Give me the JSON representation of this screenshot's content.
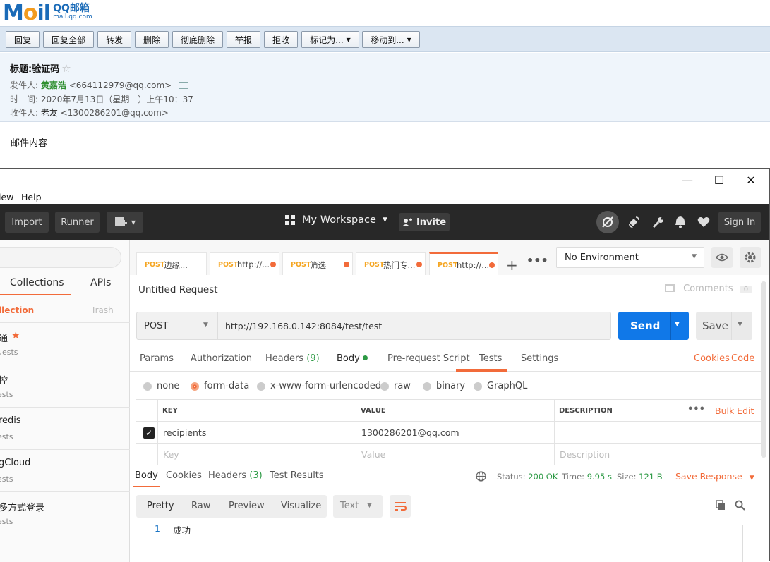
{
  "mail": {
    "logo": {
      "word_m": "M",
      "word_o": "o",
      "word_il": "il",
      "brand": "QQ邮箱",
      "domain": "mail.qq.com"
    },
    "toolbar": [
      "回复",
      "回复全部",
      "转发",
      "删除",
      "彻底删除",
      "举报",
      "拒收",
      "标记为...",
      "移动到..."
    ],
    "subject": "标题:验证码",
    "sender_label": "发件人:",
    "sender_name": "黄嘉浩",
    "sender_email": "<664112979@qq.com>",
    "time_label": "时　间:",
    "time_value": "2020年7月13日（星期一）上午10：37",
    "recipient_label": "收件人:",
    "recipient_name": "老友",
    "recipient_email": "<1300286201@qq.com>",
    "body": "邮件内容"
  },
  "postman": {
    "window_controls": [
      "—",
      "☐",
      "✕"
    ],
    "menu": [
      "iew",
      "Help"
    ],
    "header": {
      "import": "Import",
      "runner": "Runner",
      "workspace": "My Workspace",
      "invite": "Invite",
      "sign_in": "Sign In"
    },
    "sidebar": {
      "tab_collections": "Collections",
      "tab_apis": "APIs",
      "sub_left": "llection",
      "sub_trash": "Trash",
      "items": [
        {
          "title": "通",
          "sub": "uests",
          "starred": true
        },
        {
          "title": "控",
          "sub": "ests"
        },
        {
          "title": "redis",
          "sub": "ests"
        },
        {
          "title": "gCloud",
          "sub": "ests"
        },
        {
          "title": "多方式登录",
          "sub": "ests"
        }
      ]
    },
    "tabs": [
      {
        "method": "POST",
        "name": "边缘..."
      },
      {
        "method": "POST",
        "name": "http://..."
      },
      {
        "method": "POST",
        "name": "筛选"
      },
      {
        "method": "POST",
        "name": "热门专..."
      },
      {
        "method": "POST",
        "name": "http://..."
      }
    ],
    "environment": "No Environment",
    "request": {
      "title": "Untitled Request",
      "comments": "Comments",
      "comments_count": "0",
      "method": "POST",
      "url": "http://192.168.0.142:8084/test/test",
      "send": "Send",
      "save": "Save"
    },
    "subtabs": {
      "params": "Params",
      "authorization": "Authorization",
      "headers": "Headers",
      "headers_count": "(9)",
      "body": "Body",
      "prerequest": "Pre-request Script",
      "tests": "Tests",
      "settings": "Settings",
      "cookies": "Cookies",
      "code": "Code"
    },
    "body_types": [
      "none",
      "form-data",
      "x-www-form-urlencoded",
      "raw",
      "binary",
      "GraphQL"
    ],
    "selected_body_type": "form-data",
    "table": {
      "key_header": "KEY",
      "value_header": "VALUE",
      "desc_header": "DESCRIPTION",
      "bulk_edit": "Bulk Edit",
      "row_key": "recipients",
      "row_value": "1300286201@qq.com",
      "ph_key": "Key",
      "ph_value": "Value",
      "ph_desc": "Description"
    },
    "response": {
      "tab_body": "Body",
      "tab_cookies": "Cookies",
      "tab_headers": "Headers",
      "headers_count": "(3)",
      "tab_tests": "Test Results",
      "status_label": "Status:",
      "status_value": "200 OK",
      "time_label": "Time:",
      "time_value": "9.95 s",
      "size_label": "Size:",
      "size_value": "121 B",
      "save_response": "Save Response",
      "formats": [
        "Pretty",
        "Raw",
        "Preview",
        "Visualize"
      ],
      "text_select": "Text",
      "line_number": "1",
      "content": "成功"
    },
    "accent_color": "#f26b3a",
    "send_color": "#1078e8"
  }
}
